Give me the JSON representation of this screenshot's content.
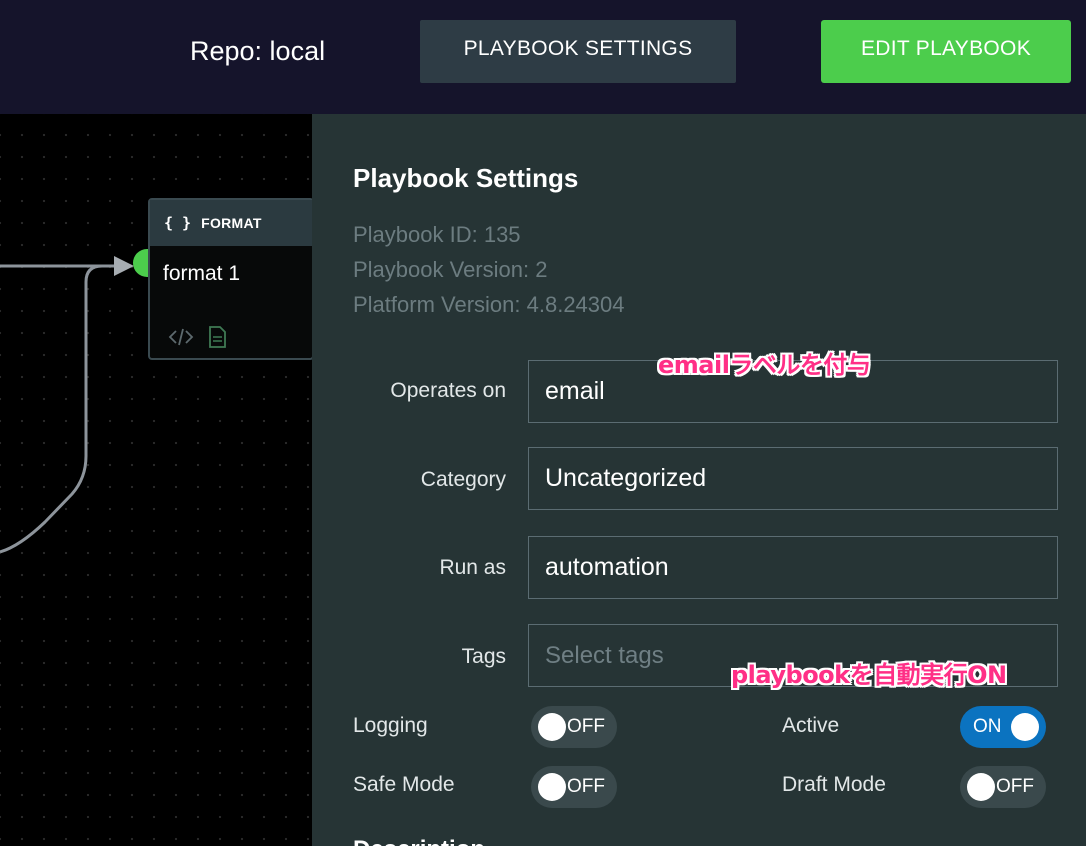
{
  "header": {
    "repo": "Repo: local",
    "settings_button": "PLAYBOOK SETTINGS",
    "edit_button": "EDIT PLAYBOOK"
  },
  "canvas": {
    "node": {
      "type_icon": "{ }",
      "type": "FORMAT",
      "title": "format 1",
      "icons": [
        "code-icon",
        "document-icon"
      ]
    }
  },
  "panel": {
    "title": "Playbook Settings",
    "playbook_id": "Playbook ID: 135",
    "playbook_version": "Playbook Version: 2",
    "platform_version": "Platform Version: 4.8.24304",
    "fields": {
      "operates_on": {
        "label": "Operates on",
        "value": "email"
      },
      "category": {
        "label": "Category",
        "value": "Uncategorized"
      },
      "run_as": {
        "label": "Run as",
        "value": "automation"
      },
      "tags": {
        "label": "Tags",
        "placeholder": "Select tags"
      }
    },
    "toggles": {
      "logging": {
        "label": "Logging",
        "state": "OFF"
      },
      "safe_mode": {
        "label": "Safe Mode",
        "state": "OFF"
      },
      "active": {
        "label": "Active",
        "state": "ON"
      },
      "draft_mode": {
        "label": "Draft Mode",
        "state": "OFF"
      }
    },
    "description_label": "Description"
  },
  "annotations": {
    "email_note": "emailラベルを付与",
    "active_note": "playbookを自動実行ON"
  },
  "colors": {
    "topbar": "#15142b",
    "panel": "#263435",
    "edit_button": "#4ccd4c",
    "toggle_on": "#0b73c0",
    "annotation": "#ff2f86"
  }
}
